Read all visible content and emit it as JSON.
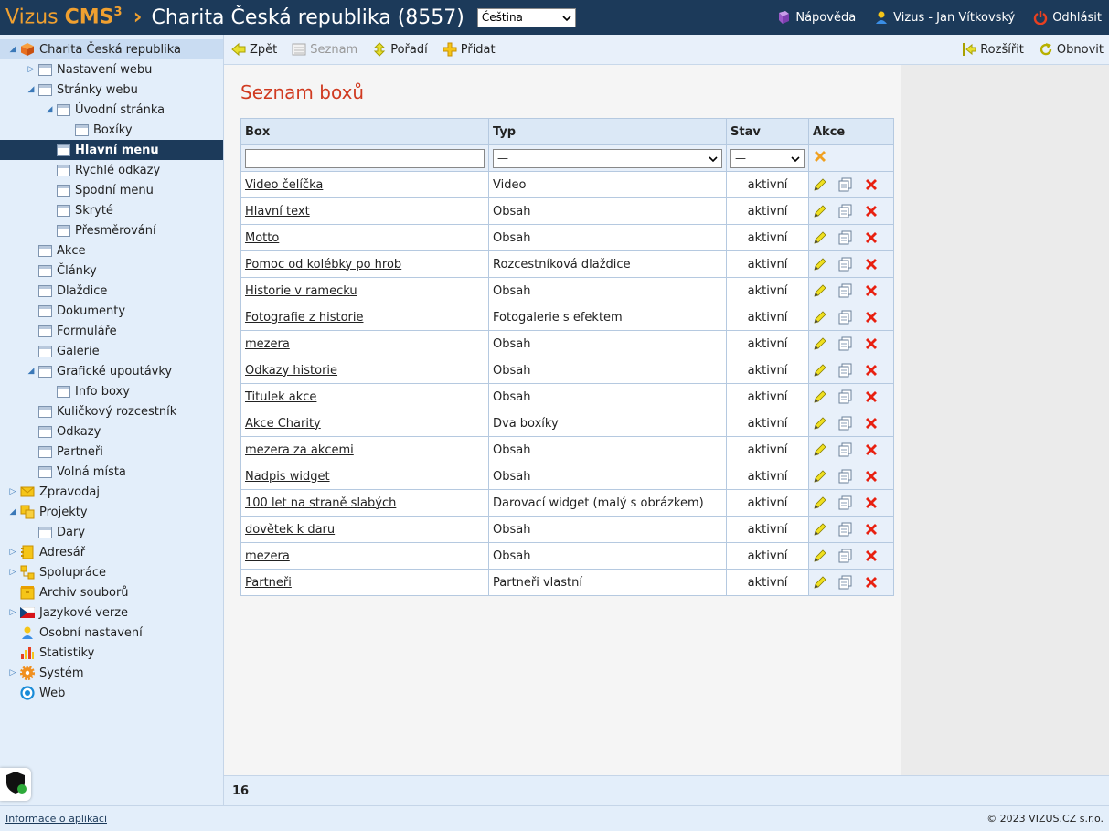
{
  "header": {
    "logo_text": "Vizus",
    "logo_bold": "CMS",
    "logo_sup": "3",
    "site_title": "Charita Česká republika (8557)",
    "language": "Čeština",
    "help": "Nápověda",
    "user": "Vizus - Jan Vítkovský",
    "logout": "Odhlásit"
  },
  "sidebar": {
    "items": [
      {
        "label": "Charita Česká republika"
      },
      {
        "label": "Nastavení webu"
      },
      {
        "label": "Stránky webu"
      },
      {
        "label": "Úvodní stránka"
      },
      {
        "label": "Boxíky"
      },
      {
        "label": "Hlavní menu"
      },
      {
        "label": "Rychlé odkazy"
      },
      {
        "label": "Spodní menu"
      },
      {
        "label": "Skryté"
      },
      {
        "label": "Přesměrování"
      },
      {
        "label": "Akce"
      },
      {
        "label": "Články"
      },
      {
        "label": "Dlaždice"
      },
      {
        "label": "Dokumenty"
      },
      {
        "label": "Formuláře"
      },
      {
        "label": "Galerie"
      },
      {
        "label": "Grafické upoutávky"
      },
      {
        "label": "Info boxy"
      },
      {
        "label": "Kuličkový rozcestník"
      },
      {
        "label": "Odkazy"
      },
      {
        "label": "Partneři"
      },
      {
        "label": "Volná místa"
      },
      {
        "label": "Zpravodaj"
      },
      {
        "label": "Projekty"
      },
      {
        "label": "Dary"
      },
      {
        "label": "Adresář"
      },
      {
        "label": "Spolupráce"
      },
      {
        "label": "Archiv souborů"
      },
      {
        "label": "Jazykové verze"
      },
      {
        "label": "Osobní nastavení"
      },
      {
        "label": "Statistiky"
      },
      {
        "label": "Systém"
      },
      {
        "label": "Web"
      }
    ]
  },
  "toolbar": {
    "back": "Zpět",
    "list": "Seznam",
    "order": "Pořadí",
    "add": "Přidat",
    "expand": "Rozšířit",
    "refresh": "Obnovit"
  },
  "main": {
    "title": "Seznam boxů",
    "columns": {
      "box": "Box",
      "type": "Typ",
      "state": "Stav",
      "actions": "Akce"
    },
    "filter": {
      "type_value": "—",
      "state_value": "—"
    },
    "rows": [
      {
        "box": "Video čelíčka",
        "type": "Video",
        "state": "aktivní"
      },
      {
        "box": "Hlavní text",
        "type": "Obsah",
        "state": "aktivní"
      },
      {
        "box": "Motto",
        "type": "Obsah",
        "state": "aktivní"
      },
      {
        "box": "Pomoc od kolébky po hrob",
        "type": "Rozcestníková dlaždice",
        "state": "aktivní"
      },
      {
        "box": "Historie v ramecku",
        "type": "Obsah",
        "state": "aktivní"
      },
      {
        "box": "Fotografie z historie",
        "type": "Fotogalerie s efektem",
        "state": "aktivní"
      },
      {
        "box": "mezera",
        "type": "Obsah",
        "state": "aktivní"
      },
      {
        "box": "Odkazy historie",
        "type": "Obsah",
        "state": "aktivní"
      },
      {
        "box": "Titulek akce",
        "type": "Obsah",
        "state": "aktivní"
      },
      {
        "box": "Akce Charity",
        "type": "Dva boxíky",
        "state": "aktivní"
      },
      {
        "box": "mezera za akcemi",
        "type": "Obsah",
        "state": "aktivní"
      },
      {
        "box": "Nadpis widget",
        "type": "Obsah",
        "state": "aktivní"
      },
      {
        "box": "100 let na straně slabých",
        "type": "Darovací widget (malý s obrázkem)",
        "state": "aktivní"
      },
      {
        "box": "dovětek k daru",
        "type": "Obsah",
        "state": "aktivní"
      },
      {
        "box": "mezera",
        "type": "Obsah",
        "state": "aktivní"
      },
      {
        "box": "Partneři",
        "type": "Partneři vlastní",
        "state": "aktivní"
      }
    ],
    "count": "16"
  },
  "footer": {
    "info_link": "Informace o aplikaci",
    "copyright": "© 2023 VIZUS.CZ s.r.o."
  },
  "colors": {
    "header_bg": "#1c3a5a",
    "accent_orange": "#f0a030",
    "title_red": "#d03a20",
    "sidebar_bg": "#e3eefa"
  }
}
